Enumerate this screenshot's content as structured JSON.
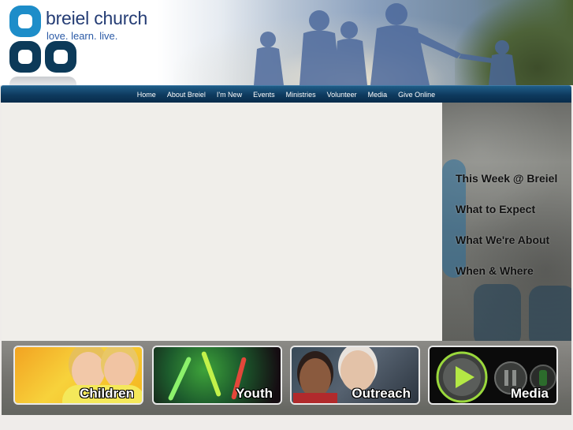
{
  "brand": {
    "name": "breiel church",
    "tagline": "love. learn. live.",
    "colors": {
      "primary_navy": "#243c74",
      "accent_blue": "#2b5aa6",
      "logo_dark": "#0c3a59",
      "logo_light": "#1d8dc9"
    }
  },
  "nav": {
    "items": [
      {
        "label": "Home"
      },
      {
        "label": "About Breiel"
      },
      {
        "label": "I'm New"
      },
      {
        "label": "Events"
      },
      {
        "label": "Ministries"
      },
      {
        "label": "Volunteer"
      },
      {
        "label": "Media"
      },
      {
        "label": "Give Online"
      }
    ]
  },
  "sidebar": {
    "items": [
      {
        "label": "This Week @ Breiel"
      },
      {
        "label": "What to Expect"
      },
      {
        "label": "What We're About"
      },
      {
        "label": "When & Where"
      }
    ]
  },
  "features": {
    "tiles": [
      {
        "label": "Children"
      },
      {
        "label": "Youth"
      },
      {
        "label": "Outreach"
      },
      {
        "label": "Media"
      }
    ]
  },
  "icons": {
    "media_tile": [
      "play-icon",
      "pause-icon"
    ]
  }
}
